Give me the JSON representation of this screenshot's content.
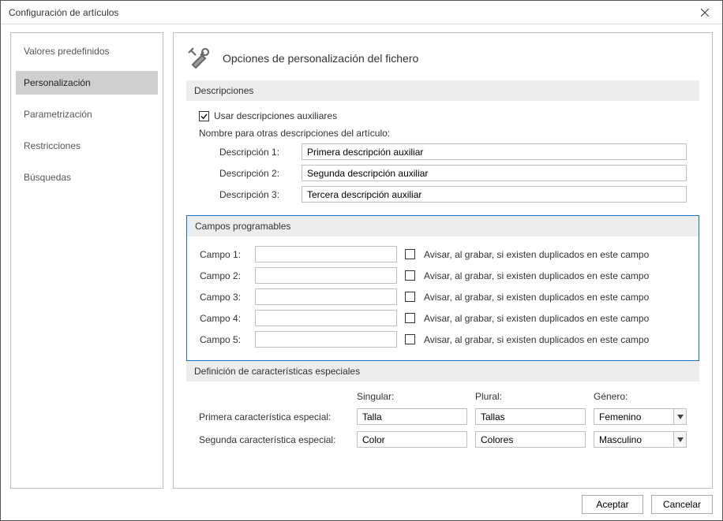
{
  "window": {
    "title": "Configuración de artículos"
  },
  "sidebar": {
    "items": [
      {
        "label": "Valores predefinidos"
      },
      {
        "label": "Personalización"
      },
      {
        "label": "Parametrización"
      },
      {
        "label": "Restricciones"
      },
      {
        "label": "Búsquedas"
      }
    ],
    "selected_index": 1
  },
  "main": {
    "heading": "Opciones de personalización del fichero",
    "descripciones": {
      "title": "Descripciones",
      "use_aux_label": "Usar descripciones auxiliares",
      "use_aux_checked": true,
      "legend": "Nombre para otras descripciones del artículo:",
      "rows": [
        {
          "label": "Descripción 1:",
          "value": "Primera descripción auxiliar"
        },
        {
          "label": "Descripción 2:",
          "value": "Segunda descripción auxiliar"
        },
        {
          "label": "Descripción 3:",
          "value": "Tercera descripción auxiliar"
        }
      ]
    },
    "campos": {
      "title": "Campos programables",
      "warn_label": "Avisar, al grabar, si existen duplicados en este campo",
      "rows": [
        {
          "label": "Campo 1:",
          "value": "",
          "warn": false
        },
        {
          "label": "Campo 2:",
          "value": "",
          "warn": false
        },
        {
          "label": "Campo 3:",
          "value": "",
          "warn": false
        },
        {
          "label": "Campo 4:",
          "value": "",
          "warn": false
        },
        {
          "label": "Campo 5:",
          "value": "",
          "warn": false
        }
      ]
    },
    "especiales": {
      "title": "Definición de características especiales",
      "headers": {
        "singular": "Singular:",
        "plural": "Plural:",
        "genero": "Género:"
      },
      "rows": [
        {
          "label": "Primera característica especial:",
          "singular": "Talla",
          "plural": "Tallas",
          "genero": "Femenino"
        },
        {
          "label": "Segunda característica especial:",
          "singular": "Color",
          "plural": "Colores",
          "genero": "Masculino"
        }
      ]
    }
  },
  "footer": {
    "ok": "Aceptar",
    "cancel": "Cancelar"
  }
}
